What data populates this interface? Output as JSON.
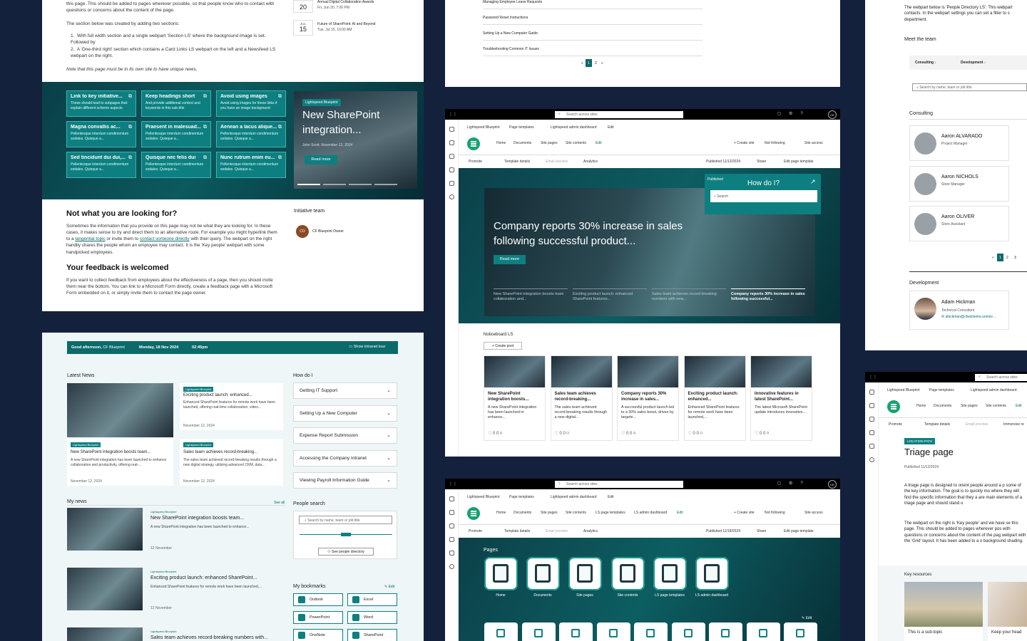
{
  "p1": {
    "intro": "this page. This should be added to pages wherever possible, so that people know who to contact with questions or concerns about the content of the page.",
    "section_intro": "The section below was created by adding two sections:",
    "list": [
      "With full width section and a single webpart 'Section LS' where the background image is set. Followed by",
      "A 'One-third right' section which contains a Card Links LS webpart on the left and a Newsfeed LS webpart on the right."
    ],
    "note": "Note that this page must be in its own site to have unique news.",
    "events": [
      {
        "day": "20",
        "line1": "Annual Digital Collaboration Awards",
        "line2": "Fri, Jun 20, 7:00 PM"
      },
      {
        "month": "JUL",
        "day": "15",
        "line1": "Future of SharePoint: AI and Beyond",
        "line2": "Tue, Jul 15, 10:00 AM"
      }
    ],
    "tiles": [
      {
        "title": "Link to key initiative...",
        "desc": "These should lead to subpages that explain different scheme aspects"
      },
      {
        "title": "Keep headings short",
        "desc": "And provide additional context and keywords in this sub-title"
      },
      {
        "title": "Avoid using images",
        "desc": "Avoid using images for these links if you have an image background"
      },
      {
        "title": "Magna convallis ac...",
        "desc": "Pellentesque interdum condimentum sodales. Quisque a..."
      },
      {
        "title": "Praesent in malesuad...",
        "desc": "Pellentesque interdum condimentum sodales. Quisque a..."
      },
      {
        "title": "Aenean a lacus alique...",
        "desc": "Pellentesque interdum condimentum sodales. Quisque a..."
      },
      {
        "title": "Sed tincidunt dui dui,...",
        "desc": "Pellentesque interdum condimentum sodales. Quisque a..."
      },
      {
        "title": "Quisque nec felis dui",
        "desc": "Pellentesque interdum condimentum sodales. Quisque a..."
      },
      {
        "title": "Nunc rutrum enim eu...",
        "desc": "Pellentesque interdum condimentum sodales. Quisque a..."
      }
    ],
    "news": {
      "badge": "Lightspeed Blueprint",
      "title": "New SharePoint integration...",
      "meta": "John Scott, November 12, 2024",
      "button": "Read more"
    },
    "h_not": "Not what you are looking for?",
    "p_not_1": "Sometimes the information that you provide on this page may not be what they are looking for. In these cases, it makes sense to try and direct them to an alternative route. For example you might hyperlink them to a",
    "link1": "tangential topic",
    "p_not_2": "or invite them to",
    "link2": "contact someone directly",
    "p_not_3": "with their query. The webpart on the right handily shares the people whom an employee may contact. It is the 'Key people' webpart with some handpicked employees.",
    "h_feedback": "Your feedback is welcomed",
    "p_feedback": "If you want to collect feedback from employees about the effectiveness of a page, then you should invite them near the bottom. You can link to a Microsoft Form directly, create a feedback page with a Microsoft Form embedded on it, or simply invite them to contact the page owner.",
    "initiative_title": "Initiative team",
    "owner_initials": "CO",
    "owner_name": "CF Blueprint Owner"
  },
  "p2": {
    "greeting": "Good afternoon,",
    "greeting_name": "CF Blueprint",
    "date": "Monday, 18 Nov 2024",
    "time": "02:45pm",
    "tour": "Show intranet tour",
    "latest_title": "Latest News",
    "latest": [
      {
        "badge": "Lightspeed Blueprint",
        "title": "Exciting product launch: enhanced...",
        "desc": "Enhanced SharePoint features for remote work have been launched, offering real-time collaboration, video...",
        "date": "November 12, 2024"
      },
      {
        "badge": "Lightspeed Blueprint",
        "title": "New SharePoint integration boosts team...",
        "desc": "A new SharePoint integration has been launched to enhance collaboration and productivity, offering real-...",
        "date": "November 12, 2024"
      },
      {
        "badge": "Lightspeed Blueprint",
        "title": "Sales team achieves record-breaking...",
        "desc": "The sales team achieved record-breaking results through a new digital strategy, utilizing advanced CRM, data...",
        "date": "November 12, 2024"
      }
    ],
    "howdoi_title": "How do I",
    "howdoi": [
      "Getting IT Support",
      "Setting Up a New Computer",
      "Expense Report Submission",
      "Accessing the Company Intranet",
      "Viewing Payroll Information Guide"
    ],
    "mynews_title": "My news",
    "see_all": "See all",
    "mynews": [
      {
        "badge": "Lightspeed Blueprint",
        "title": "New SharePoint integration boosts team...",
        "desc": "A new SharePoint integration has been launched to enhance...",
        "date": "12 November"
      },
      {
        "badge": "Lightspeed Blueprint",
        "title": "Exciting product launch: enhanced SharePoint...",
        "desc": "Enhanced SharePoint features for remote work have been launched,...",
        "date": "12 November"
      },
      {
        "badge": "Lightspeed Blueprint",
        "title": "Sales team achieves record-breaking numbers with...",
        "desc": "",
        "date": ""
      }
    ],
    "people_title": "People search",
    "people_placeholder": "Search by name, team or job title",
    "people_button": "See people directory",
    "slider_value": "0 KM",
    "bookmarks_title": "My bookmarks",
    "edit": "Edit",
    "bookmarks": [
      "Outlook",
      "Excel",
      "PowerPoint",
      "Word",
      "OneNote",
      "SharePoint"
    ]
  },
  "p3": {
    "links": [
      "Managing Employee Leave Requests",
      "Password Reset Instructions",
      "Setting Up a New Computer Guide",
      "Troubleshooting Common IT Issues"
    ],
    "pages": [
      "1",
      "2"
    ],
    "first": "«",
    "last": "»"
  },
  "p4": {
    "search": "Search across sites",
    "user_initials": "CE",
    "site_name": "Lightspeed Blueprint",
    "page_templates": "Page templates",
    "admin_dash": "Lightspeed admin dashboard",
    "edit": "Edit",
    "nav": [
      "Home",
      "Documents",
      "Site pages",
      "Site contents",
      "Edit"
    ],
    "actions": [
      "+ Create site",
      "Not following",
      "Site access"
    ],
    "cmd": [
      "Promote",
      "Template details",
      "Email preview",
      "Analytics"
    ],
    "published": "Published 11/12/2024",
    "share": "Share",
    "edit_template": "Edit page template",
    "hero_title": "Company reports 30% increase in sales following successful product...",
    "hero_button": "Read more",
    "howdoi_badge": "Published",
    "howdoi_title": "How do I?",
    "howdoi_search": "Search",
    "strip": [
      "New SharePoint integration boosts team collaboration and...",
      "Exciting product launch: enhanced SharePoint features...",
      "Sales team achieves record-breaking numbers with new...",
      "Company reports 30% increase in sales following successful..."
    ],
    "noticeboard_title": "Noticeboard LS",
    "create_post": "+ Create post",
    "cards": [
      {
        "title": "New SharePoint integration boosts...",
        "desc": "A new SharePoint integration has been launched to enhance..."
      },
      {
        "title": "Sales team achieves record-breaking...",
        "desc": "The sales team achieved record-breaking results through a new digital..."
      },
      {
        "title": "Company reports 30% increase in sales...",
        "desc": "A successful product launch led to a 30% sales boost, driven by targete..."
      },
      {
        "title": "Exciting product launch: enhanced...",
        "desc": "Enhanced SharePoint features for remote work have been launched,..."
      },
      {
        "title": "Innovative features in latest SharePoint...",
        "desc": "The latest Microsoft SharePoint update introduces innovative..."
      }
    ],
    "card_counts": "0  0"
  },
  "p6": {
    "search": "Search across sites",
    "user_initials": "CE",
    "site_name": "Lightspeed Blueprint",
    "page_templates": "Page templates",
    "admin_dash": "Lightspeed admin dashboard",
    "edit": "Edit",
    "nav": [
      "Home",
      "Documents",
      "Site pages",
      "Site contents",
      "LS page templates",
      "LS admin dashboard",
      "Edit"
    ],
    "actions": [
      "+ Create site",
      "Not following",
      "Site access"
    ],
    "cmd": [
      "Promote",
      "Template details",
      "Email preview",
      "Analytics"
    ],
    "published": "Published 11/18/2024",
    "share": "Share",
    "edit_template": "Edit page template",
    "pages_title": "Pages",
    "tiles": [
      "Home",
      "Documents",
      "Site pages",
      "Site contents",
      "LS page templates",
      "LS admin dashboard"
    ],
    "edit2": "Edit"
  },
  "p5": {
    "intro": "The webpart below is 'People Directory LS'. This webpart contacts. In the webpart settings you can set a filter to s department.",
    "meet": "Meet the team",
    "filters": [
      "Consulting",
      "Development"
    ],
    "search": "Search by name, team or job title",
    "consulting": "Consulting",
    "people": [
      {
        "name": "Aaron ALVARADO",
        "role": "Project Manager"
      },
      {
        "name": "Aaron NICHOLS",
        "role": "Store Manager"
      },
      {
        "name": "Aaron OLIVER",
        "role": "Store Assistant"
      }
    ],
    "pages": [
      "1",
      "2",
      "3"
    ],
    "development": "Development",
    "dev_person": {
      "name": "Adam Hickman",
      "role": "Technical Consultant",
      "email": "ahickman@cfwizdemo.onmicr..."
    }
  },
  "p7": {
    "search": "Search across sites",
    "site_name": "Lightspeed Blueprint",
    "page_templates": "Page templates",
    "admin_dash": "Lightspeed admin dashboard",
    "nav": [
      "Home",
      "Documents",
      "Site pages",
      "Site contents",
      "Edit"
    ],
    "cmd": [
      "Promote",
      "Template details",
      "Email preview",
      "Immersive re"
    ],
    "badge": "LOCATION PATH",
    "title": "Triage page",
    "published": "Published 11/12/2024",
    "p1": "A triage page is designed to orient people around a p some of the key information. The goal is to quickly mo where they will find the specific information that they a are main elements of a triage page and should stand o",
    "p2": "The webpart on the right is 'Key people' and we have se this page. This should be added to pages wherever pos with questions or concerns about the content of the pag webpart with the 'Grid' layout. It has been added to a o background shading.",
    "key_title": "Key resources",
    "res1": "This is a sub-topic",
    "res2": "Keep your head"
  }
}
